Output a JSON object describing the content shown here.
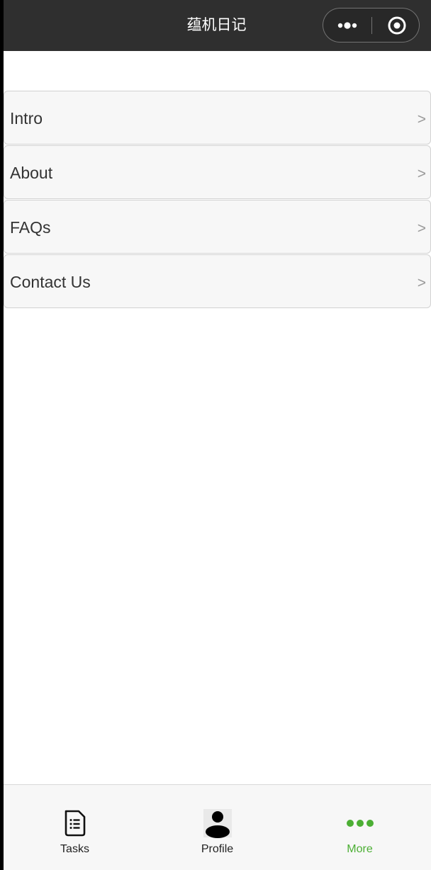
{
  "header": {
    "title": "蕴机日记"
  },
  "menu": {
    "items": [
      {
        "label": "Intro",
        "arrow": ">"
      },
      {
        "label": "About",
        "arrow": ">"
      },
      {
        "label": "FAQs",
        "arrow": ">"
      },
      {
        "label": "Contact Us",
        "arrow": ">"
      }
    ]
  },
  "tabbar": {
    "tabs": [
      {
        "label": "Tasks",
        "icon": "document-list-icon"
      },
      {
        "label": "Profile",
        "icon": "person-icon"
      },
      {
        "label": "More",
        "icon": "more-dots-icon",
        "active": true
      }
    ],
    "active_color": "#4caf34"
  },
  "colors": {
    "topbar_bg": "#2f2f2f",
    "item_bg": "#f7f7f7"
  }
}
